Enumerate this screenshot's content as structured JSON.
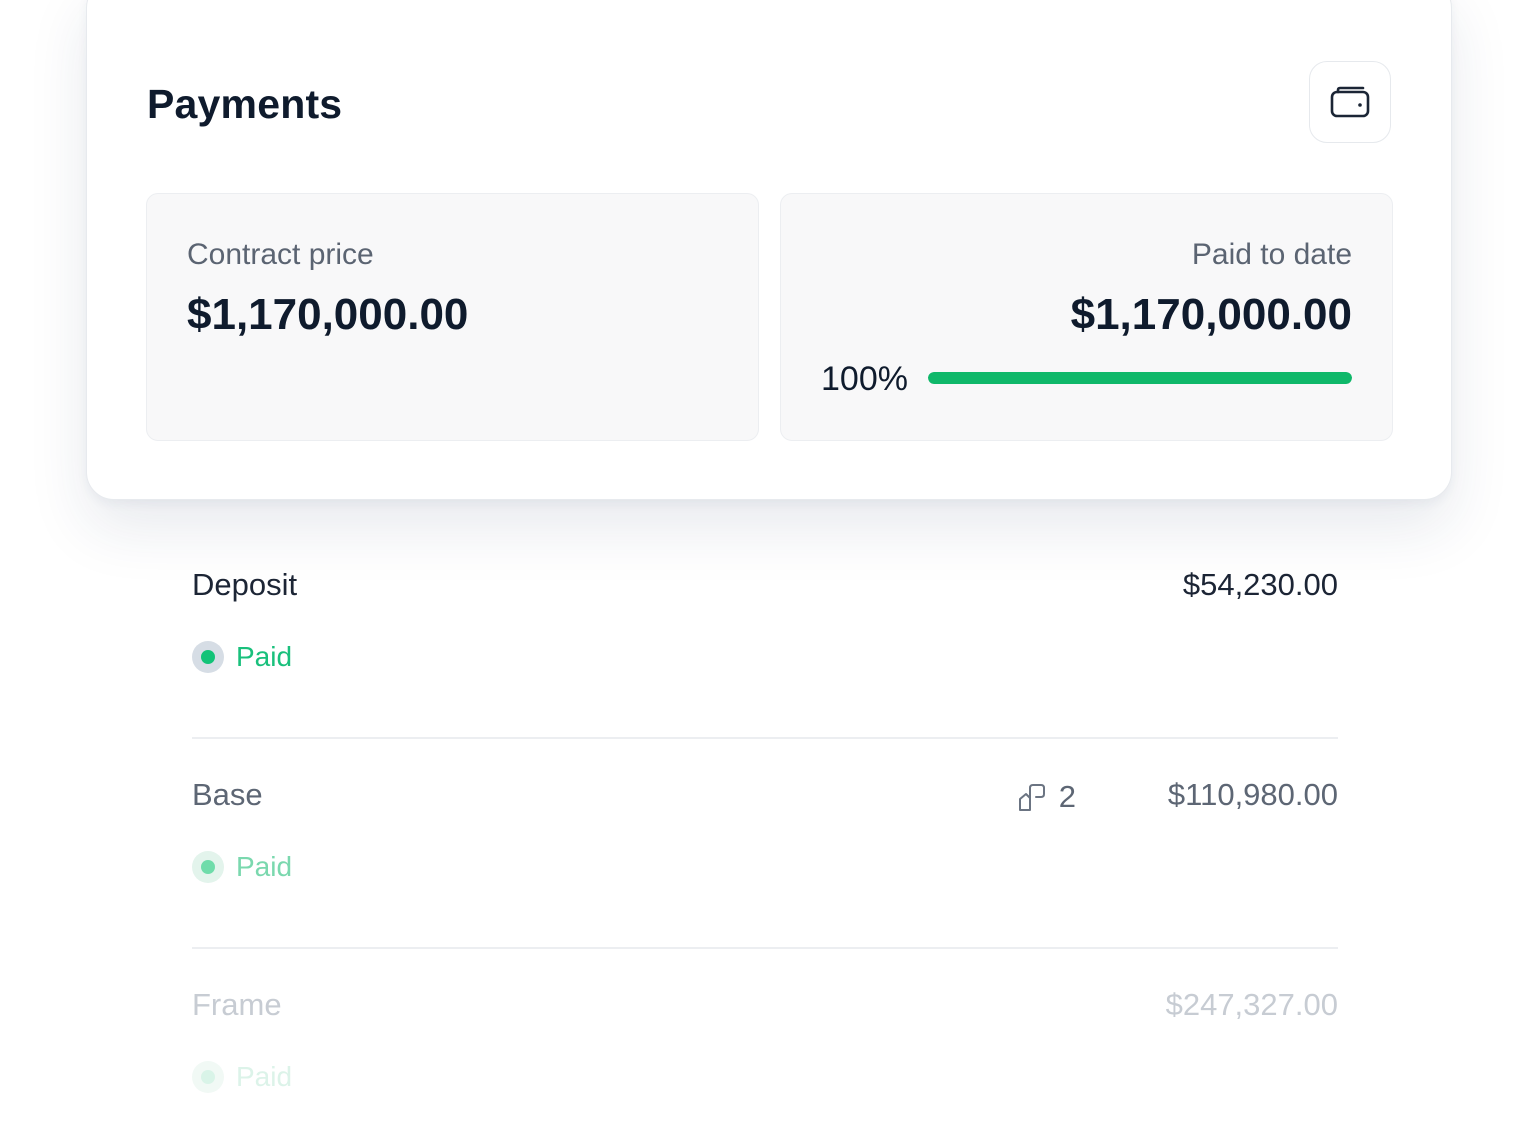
{
  "header": {
    "title": "Payments",
    "wallet_icon": "wallet-icon"
  },
  "summary": {
    "contract": {
      "label": "Contract price",
      "value": "$1,170,000.00"
    },
    "paid": {
      "label": "Paid to date",
      "value": "$1,170,000.00",
      "percent_label": "100%",
      "progress_percent": 100
    }
  },
  "payments": [
    {
      "name": "Deposit",
      "amount": "$54,230.00",
      "status": "Paid"
    },
    {
      "name": "Base",
      "amount": "$110,980.00",
      "status": "Paid",
      "attachments": "2",
      "attachment_icon": "attachment-icon"
    },
    {
      "name": "Frame",
      "amount": "$247,327.00",
      "status": "Paid"
    }
  ],
  "colors": {
    "accent_green": "#0fb86a",
    "status_green": "#19c07c",
    "text_dark": "#0f1b2d"
  }
}
